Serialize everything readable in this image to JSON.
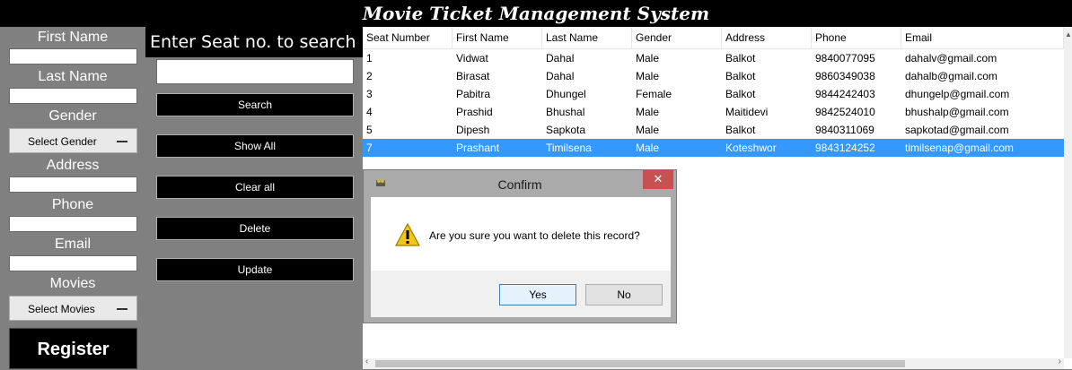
{
  "app": {
    "title": "Movie Ticket Management System"
  },
  "form": {
    "first_name_label": "First Name",
    "last_name_label": "Last Name",
    "gender_label": "Gender",
    "gender_select": "Select Gender",
    "address_label": "Address",
    "phone_label": "Phone",
    "email_label": "Email",
    "movies_label": "Movies",
    "movies_select": "Select Movies",
    "register_button": "Register"
  },
  "search": {
    "title": "Enter Seat no. to search",
    "search_button": "Search",
    "show_all_button": "Show All",
    "clear_all_button": "Clear all",
    "delete_button": "Delete",
    "update_button": "Update"
  },
  "grid": {
    "columns": [
      "Seat Number",
      "First Name",
      "Last Name",
      "Gender",
      "Address",
      "Phone",
      "Email"
    ],
    "rows": [
      [
        "1",
        "Vidwat",
        "Dahal",
        "Male",
        "Balkot",
        "9840077095",
        "dahalv@gmail.com"
      ],
      [
        "2",
        "Birasat",
        "Dahal",
        "Male",
        "Balkot",
        "9860349038",
        "dahalb@gmail.com"
      ],
      [
        "3",
        "Pabitra",
        "Dhungel",
        "Female",
        "Balkot",
        "9844242403",
        "dhungelp@gmail.com"
      ],
      [
        "4",
        "Prashid",
        "Bhushal",
        "Male",
        "Maitidevi",
        "9842524010",
        "bhushalp@gmail.com"
      ],
      [
        "5",
        "Dipesh",
        "Sapkota",
        "Male",
        "Balkot",
        "9840311069",
        "sapkotad@gmail.com"
      ],
      [
        "7",
        "Prashant",
        "Timilsena",
        "Male",
        "Koteshwor",
        "9843124252",
        "timilsenap@gmail.com"
      ]
    ],
    "selected_row": 5
  },
  "dialog": {
    "title": "Confirm",
    "close_glyph": "✕",
    "message": "Are you sure you want to delete this record?",
    "yes_button": "Yes",
    "no_button": "No"
  },
  "colors": {
    "selection": "#3399ff",
    "panel_bg": "#808080",
    "button_bg": "#000000",
    "close_button": "#c75050"
  }
}
